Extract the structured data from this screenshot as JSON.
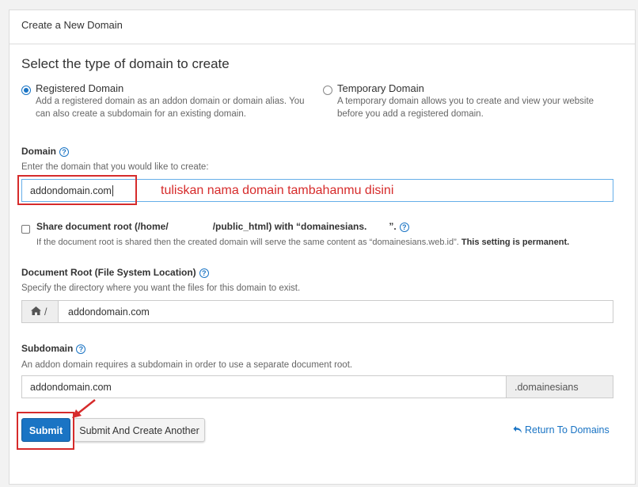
{
  "panel": {
    "title": "Create a New Domain"
  },
  "type_section": {
    "title": "Select the type of domain to create",
    "options": [
      {
        "title": "Registered Domain",
        "desc_line1": "Add a registered domain as an addon domain or domain alias. You",
        "desc_line2": "can also create a subdomain for an existing domain.",
        "selected": true
      },
      {
        "title": "Temporary Domain",
        "desc_line1": "A temporary domain allows you to create and view your website",
        "desc_line2": "before you add a registered domain.",
        "selected": false
      }
    ]
  },
  "domain": {
    "label": "Domain",
    "help": "Enter the domain that you would like to create:",
    "value": "addondomain.com",
    "annotation": "tuliskan nama domain tambahanmu disini"
  },
  "share_root": {
    "label_part1": "Share document root (/home/",
    "label_part2": "/public_html) with “domainesians.",
    "label_part3": "”.",
    "help": "If the document root is shared then the created domain will serve the same content as “domainesians.web.id”.",
    "help_bold": "This setting is permanent.",
    "checked": false
  },
  "doc_root": {
    "label": "Document Root (File System Location)",
    "help": "Specify the directory where you want the files for this domain to exist.",
    "prefix": "/",
    "value": "addondomain.com"
  },
  "subdomain": {
    "label": "Subdomain",
    "help": "An addon domain requires a subdomain in order to use a separate document root.",
    "value": "addondomain.com",
    "suffix": ".domainesians"
  },
  "actions": {
    "submit": "Submit",
    "submit_another": "Submit And Create Another",
    "return_link": "Return To Domains"
  },
  "colors": {
    "accent": "#1a74c4",
    "annotation": "#d62b2b"
  }
}
